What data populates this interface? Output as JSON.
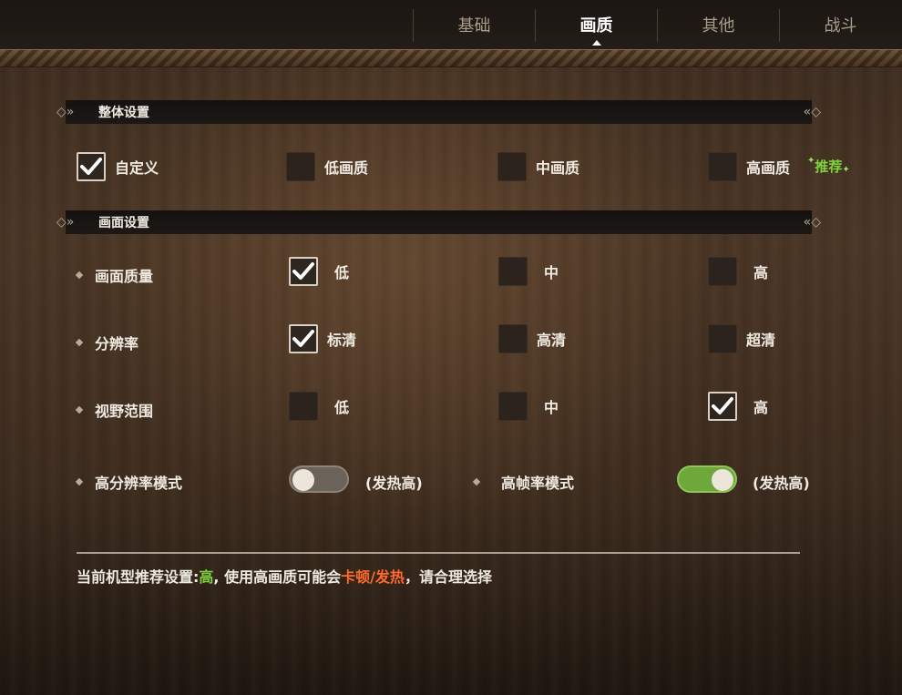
{
  "tabs": [
    {
      "label": "基础",
      "active": false
    },
    {
      "label": "画质",
      "active": true
    },
    {
      "label": "其他",
      "active": false
    },
    {
      "label": "战斗",
      "active": false
    }
  ],
  "overall": {
    "title": "整体设置",
    "options": [
      {
        "label": "自定义",
        "checked": true
      },
      {
        "label": "低画质",
        "checked": false
      },
      {
        "label": "中画质",
        "checked": false
      },
      {
        "label": "高画质",
        "checked": false
      }
    ],
    "recommend_label": "推荐"
  },
  "screen": {
    "title": "画面设置",
    "rows": [
      {
        "label": "画面质量",
        "options": [
          {
            "label": "低",
            "checked": true
          },
          {
            "label": "中",
            "checked": false
          },
          {
            "label": "高",
            "checked": false
          }
        ]
      },
      {
        "label": "分辨率",
        "options": [
          {
            "label": "标清",
            "checked": true
          },
          {
            "label": "高清",
            "checked": false
          },
          {
            "label": "超清",
            "checked": false
          }
        ]
      },
      {
        "label": "视野范围",
        "options": [
          {
            "label": "低",
            "checked": false
          },
          {
            "label": "中",
            "checked": false
          },
          {
            "label": "高",
            "checked": true
          }
        ]
      }
    ],
    "toggles": [
      {
        "label": "高分辨率模式",
        "on": false,
        "note": "(发热高)"
      },
      {
        "label": "高帧率模式",
        "on": true,
        "note": "(发热高)"
      }
    ]
  },
  "footer": {
    "prefix": "当前机型推荐设置:",
    "recommended": "高",
    "middle": ", 使用高画质可能会",
    "warning": "卡顿/发热",
    "suffix": "，请合理选择"
  },
  "colors": {
    "accent_green": "#7fd23c",
    "warning_orange": "#ff6a2a",
    "toggle_on": "#6ea83a"
  },
  "icons": {
    "check": "checkmark-icon",
    "sparkle": "sparkle-icon",
    "section_ornament": "double-chevron-icon",
    "bullet": "diamond-icon"
  }
}
